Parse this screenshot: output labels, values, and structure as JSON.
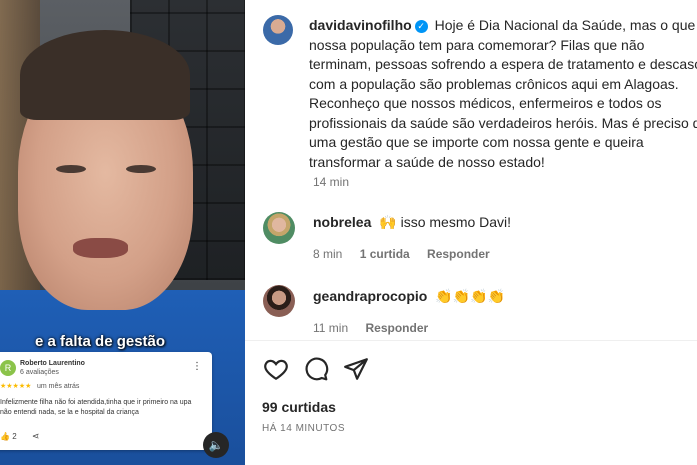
{
  "video": {
    "caption": "e a falta de gestão",
    "review": {
      "avatar_letter": "R",
      "name": "Roberto Laurentino",
      "count": "6 avaliações",
      "stars": "★★★★★",
      "time": "um mês atrás",
      "text": "Infelizmente filha não foi atendida,tinha que ir primeiro na upa não entendi nada, se la e hospital da criança",
      "likes": "2"
    },
    "mute_icon": "speaker-muted-icon"
  },
  "post": {
    "username": "davidavinofilho",
    "caption": "Hoje é Dia Nacional da Saúde, mas o que nossa população tem para comemorar? Filas que não terminam, pessoas sofrendo a espera de tratamento e descaso com a população são problemas crônicos aqui em Alagoas. Reconheço que nossos médicos, enfermeiros e todos os profissionais da saúde são verdadeiros heróis. Mas é preciso de uma gestão que se importe com nossa gente e queira transformar a saúde de nosso estado!",
    "time": "14 min"
  },
  "comments": [
    {
      "username": "nobrelea",
      "emoji": "🙌",
      "text": "isso mesmo Davi!",
      "time": "8 min",
      "likes": "1 curtida",
      "reply": "Responder"
    },
    {
      "username": "geandraprocopio",
      "emoji": "👏👏👏👏",
      "text": "",
      "time": "11 min",
      "reply": "Responder"
    }
  ],
  "footer": {
    "likes": "99 curtidas",
    "date": "HÁ 14 MINUTOS"
  },
  "colors": {
    "verified": "#0095f6",
    "shirt": "#1f5fb6"
  }
}
